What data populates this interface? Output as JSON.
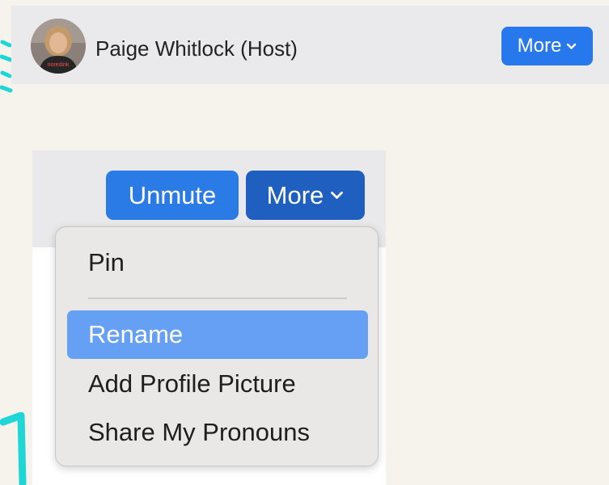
{
  "participant": {
    "name": "Paige Whitlock (Host)",
    "avatar_shirt_text": "noredink",
    "more_label": "More"
  },
  "controls": {
    "unmute_label": "Unmute",
    "more_label": "More"
  },
  "menu": {
    "items": [
      {
        "label": "Pin"
      },
      {
        "label": "Rename",
        "highlighted": true
      },
      {
        "label": "Add Profile Picture"
      },
      {
        "label": "Share My Pronouns"
      }
    ]
  },
  "colors": {
    "accent": "#2b7be6",
    "accent_pressed": "#1f5fbf",
    "menu_highlight": "#66a0f5",
    "marker": "#1fd6d6"
  },
  "icons": {
    "dropdown": "chevron-down-icon"
  }
}
